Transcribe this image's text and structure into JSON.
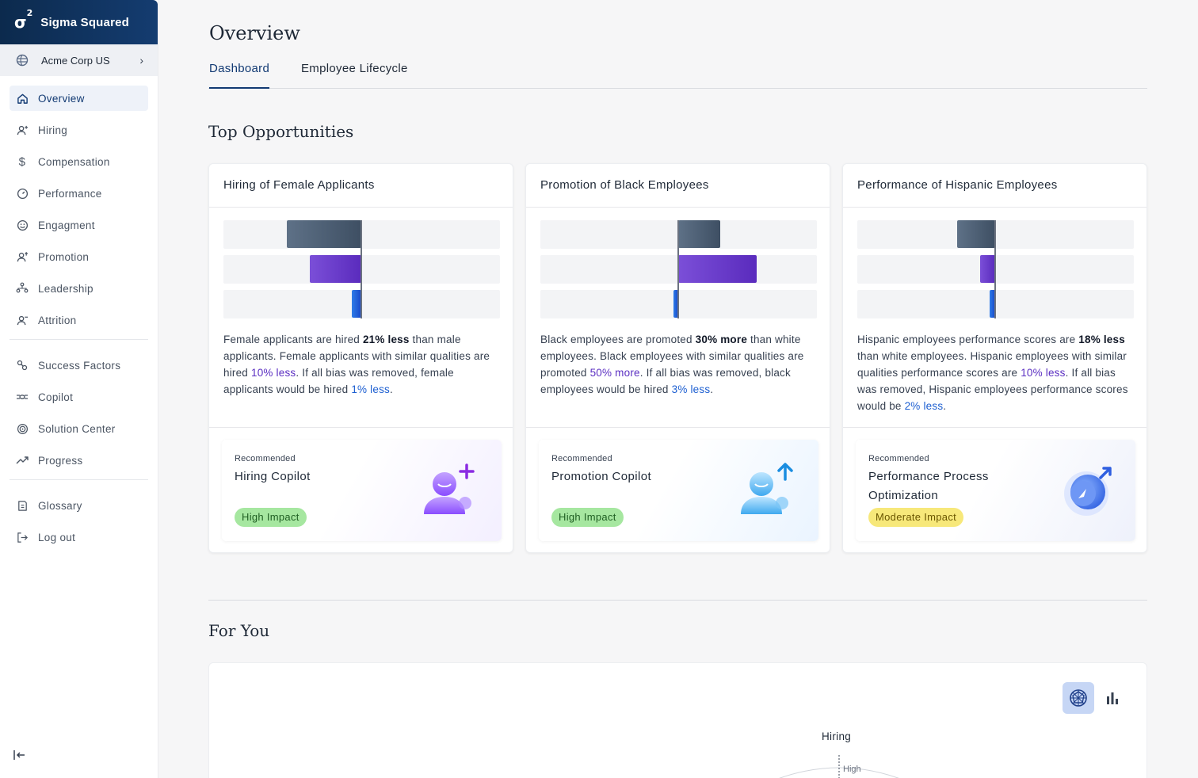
{
  "brand": {
    "logo": "σ",
    "logo_sup": "2",
    "name": "Sigma Squared"
  },
  "org": {
    "name": "Acme Corp US"
  },
  "nav": {
    "primary": [
      {
        "label": "Overview",
        "icon": "home-icon"
      },
      {
        "label": "Hiring",
        "icon": "user-plus-icon"
      },
      {
        "label": "Compensation",
        "icon": "dollar-icon"
      },
      {
        "label": "Performance",
        "icon": "gauge-icon"
      },
      {
        "label": "Engagment",
        "icon": "smile-icon"
      },
      {
        "label": "Promotion",
        "icon": "user-up-icon"
      },
      {
        "label": "Leadership",
        "icon": "org-chart-icon"
      },
      {
        "label": "Attrition",
        "icon": "user-minus-icon"
      }
    ],
    "secondary": [
      {
        "label": "Success Factors",
        "icon": "factors-icon"
      },
      {
        "label": "Copilot",
        "icon": "copilot-icon"
      },
      {
        "label": "Solution Center",
        "icon": "target-icon"
      },
      {
        "label": "Progress",
        "icon": "trend-up-icon"
      }
    ],
    "tertiary": [
      {
        "label": "Glossary",
        "icon": "book-icon"
      },
      {
        "label": "Log out",
        "icon": "logout-icon"
      }
    ]
  },
  "page": {
    "title": "Overview"
  },
  "tabs": [
    {
      "label": "Dashboard",
      "active": true
    },
    {
      "label": "Employee Lifecycle",
      "active": false
    }
  ],
  "top_opportunities": {
    "title": "Top Opportunities",
    "cards": [
      {
        "title": "Hiring of Female Applicants",
        "bars": [
          {
            "series": "raw",
            "value": -21
          },
          {
            "series": "similar",
            "value": -10
          },
          {
            "series": "bias_removed",
            "value": -1
          }
        ],
        "desc": {
          "p1": "Female applicants are hired ",
          "b1": "21% less",
          "p2": " than male applicants. Female applicants with similar qualities are hired ",
          "h1": "10% less",
          "p3": ". If all bias was removed, female applicants would be hired ",
          "h2": "1% less",
          "p4": "."
        },
        "rec": {
          "small": "Recommended",
          "title": "Hiring Copilot",
          "impact": "High Impact",
          "icon": "hiring-copilot-icon"
        }
      },
      {
        "title": "Promotion of Black Employees",
        "bars": [
          {
            "series": "raw",
            "value": 30
          },
          {
            "series": "similar",
            "value": 50
          },
          {
            "series": "bias_removed",
            "value": -3
          }
        ],
        "desc": {
          "p1": "Black employees are promoted ",
          "b1": "30% more",
          "p2": " than white employees. Black employees with similar qualities are promoted ",
          "h1": "50% more",
          "p3": ".  If all bias was removed, black employees would be hired ",
          "h2": "3% less",
          "p4": "."
        },
        "rec": {
          "small": "Recommended",
          "title": "Promotion Copilot",
          "impact": "High Impact",
          "icon": "promotion-copilot-icon"
        }
      },
      {
        "title": "Performance of Hispanic Employees",
        "bars": [
          {
            "series": "raw",
            "value": -18
          },
          {
            "series": "similar",
            "value": -10
          },
          {
            "series": "bias_removed",
            "value": -2
          }
        ],
        "desc": {
          "p1": "Hispanic employees performance scores are ",
          "b1": "18% less",
          "p2": " than white employees. Hispanic employees with similar qualities   performance scores are ",
          "h1": "10% less",
          "p3": ". If all bias was removed, Hispanic employees performance scores would be ",
          "h2": "2% less",
          "p4": "."
        },
        "rec": {
          "small": "Recommended",
          "title": "Performance Process Optimization",
          "impact": "Moderate Impact",
          "icon": "performance-compass-icon"
        }
      }
    ]
  },
  "for_you": {
    "title": "For You",
    "radar_axis_label": "Hiring",
    "radar_tick": "High"
  },
  "colors": {
    "brand_navy": "#0c2a4d",
    "active_blue": "#123a73",
    "purple_highlight": "#5b2fc2",
    "blue_highlight": "#1d5fd1",
    "high_impact_bg": "#a6e7a0",
    "moderate_impact_bg": "#f7e87a"
  }
}
